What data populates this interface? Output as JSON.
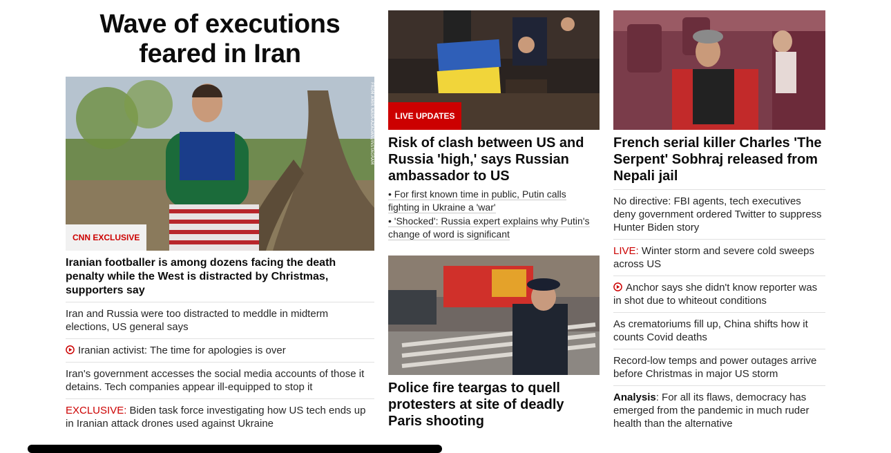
{
  "col1": {
    "headline": "Wave of executions feared in Iran",
    "badge": "CNN EXCLUSIVE",
    "photo_credit": "FROM AMIR NASR-AZADANI/INSTAGRAM",
    "lead": "Iranian footballer is among dozens facing the death penalty while the West is distracted by Christmas, supporters say",
    "stories": [
      {
        "text": "Iran and Russia were too distracted to meddle in midterm elections, US general says"
      },
      {
        "icon": "play-icon",
        "text": "Iranian activist: The time for apologies is over"
      },
      {
        "text": "Iran's government accesses the social media accounts of those it detains. Tech companies appear ill-equipped to stop it"
      },
      {
        "prefix": "EXCLUSIVE:",
        "text": " Biden task force investigating how US tech ends up in Iranian attack drones used against Ukraine"
      }
    ]
  },
  "col2": {
    "top": {
      "badge": "LIVE UPDATES",
      "headline": "Risk of clash between US and Russia 'high,' says Russian ambassador to US",
      "subs": [
        "• For first known time in public, Putin calls fighting in Ukraine a 'war'",
        "• 'Shocked': Russia expert explains why Putin's change of word is significant"
      ]
    },
    "bottom": {
      "headline": "Police fire teargas to quell protesters at site of deadly Paris shooting"
    }
  },
  "col3": {
    "headline": "French serial killer Charles 'The Serpent' Sobhraj released from Nepali jail",
    "stories": [
      {
        "text": "No directive: FBI agents, tech executives deny government ordered Twitter to suppress Hunter Biden story"
      },
      {
        "prefix": "LIVE:",
        "text": " Winter storm and severe cold sweeps across US"
      },
      {
        "icon": "play-icon",
        "text": "Anchor says she didn't know reporter was in shot due to whiteout conditions"
      },
      {
        "text": "As crematoriums fill up, China shifts how it counts Covid deaths"
      },
      {
        "text": "Record-low temps and power outages arrive before Christmas in major US storm"
      },
      {
        "bold": "Analysis",
        "text": ": For all its flaws, democracy has emerged from the pandemic in much ruder health than the alternative"
      }
    ]
  },
  "colors": {
    "accent_red": "#cc0000",
    "text": "#0c0c0c",
    "divider": "#e0e0e0"
  }
}
